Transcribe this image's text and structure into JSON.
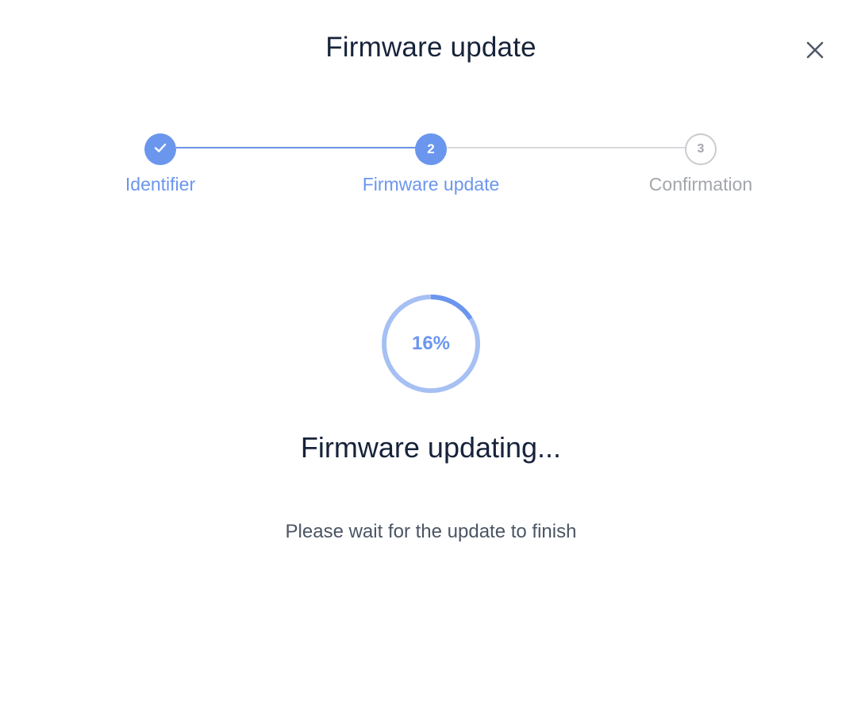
{
  "dialog": {
    "title": "Firmware update",
    "close_icon": "close-icon"
  },
  "stepper": {
    "steps": [
      {
        "number": "1",
        "label": "Identifier",
        "state": "complete",
        "icon": "check-icon"
      },
      {
        "number": "2",
        "label": "Firmware update",
        "state": "active"
      },
      {
        "number": "3",
        "label": "Confirmation",
        "state": "pending"
      }
    ]
  },
  "progress": {
    "percent": 16,
    "label": "16%"
  },
  "status": {
    "heading": "Firmware updating...",
    "message": "Please wait for the update to finish"
  },
  "colors": {
    "accent": "#6b96ee",
    "accent_light": "#a6c0f3",
    "pending": "#a3a6ab",
    "title": "#17233a"
  }
}
